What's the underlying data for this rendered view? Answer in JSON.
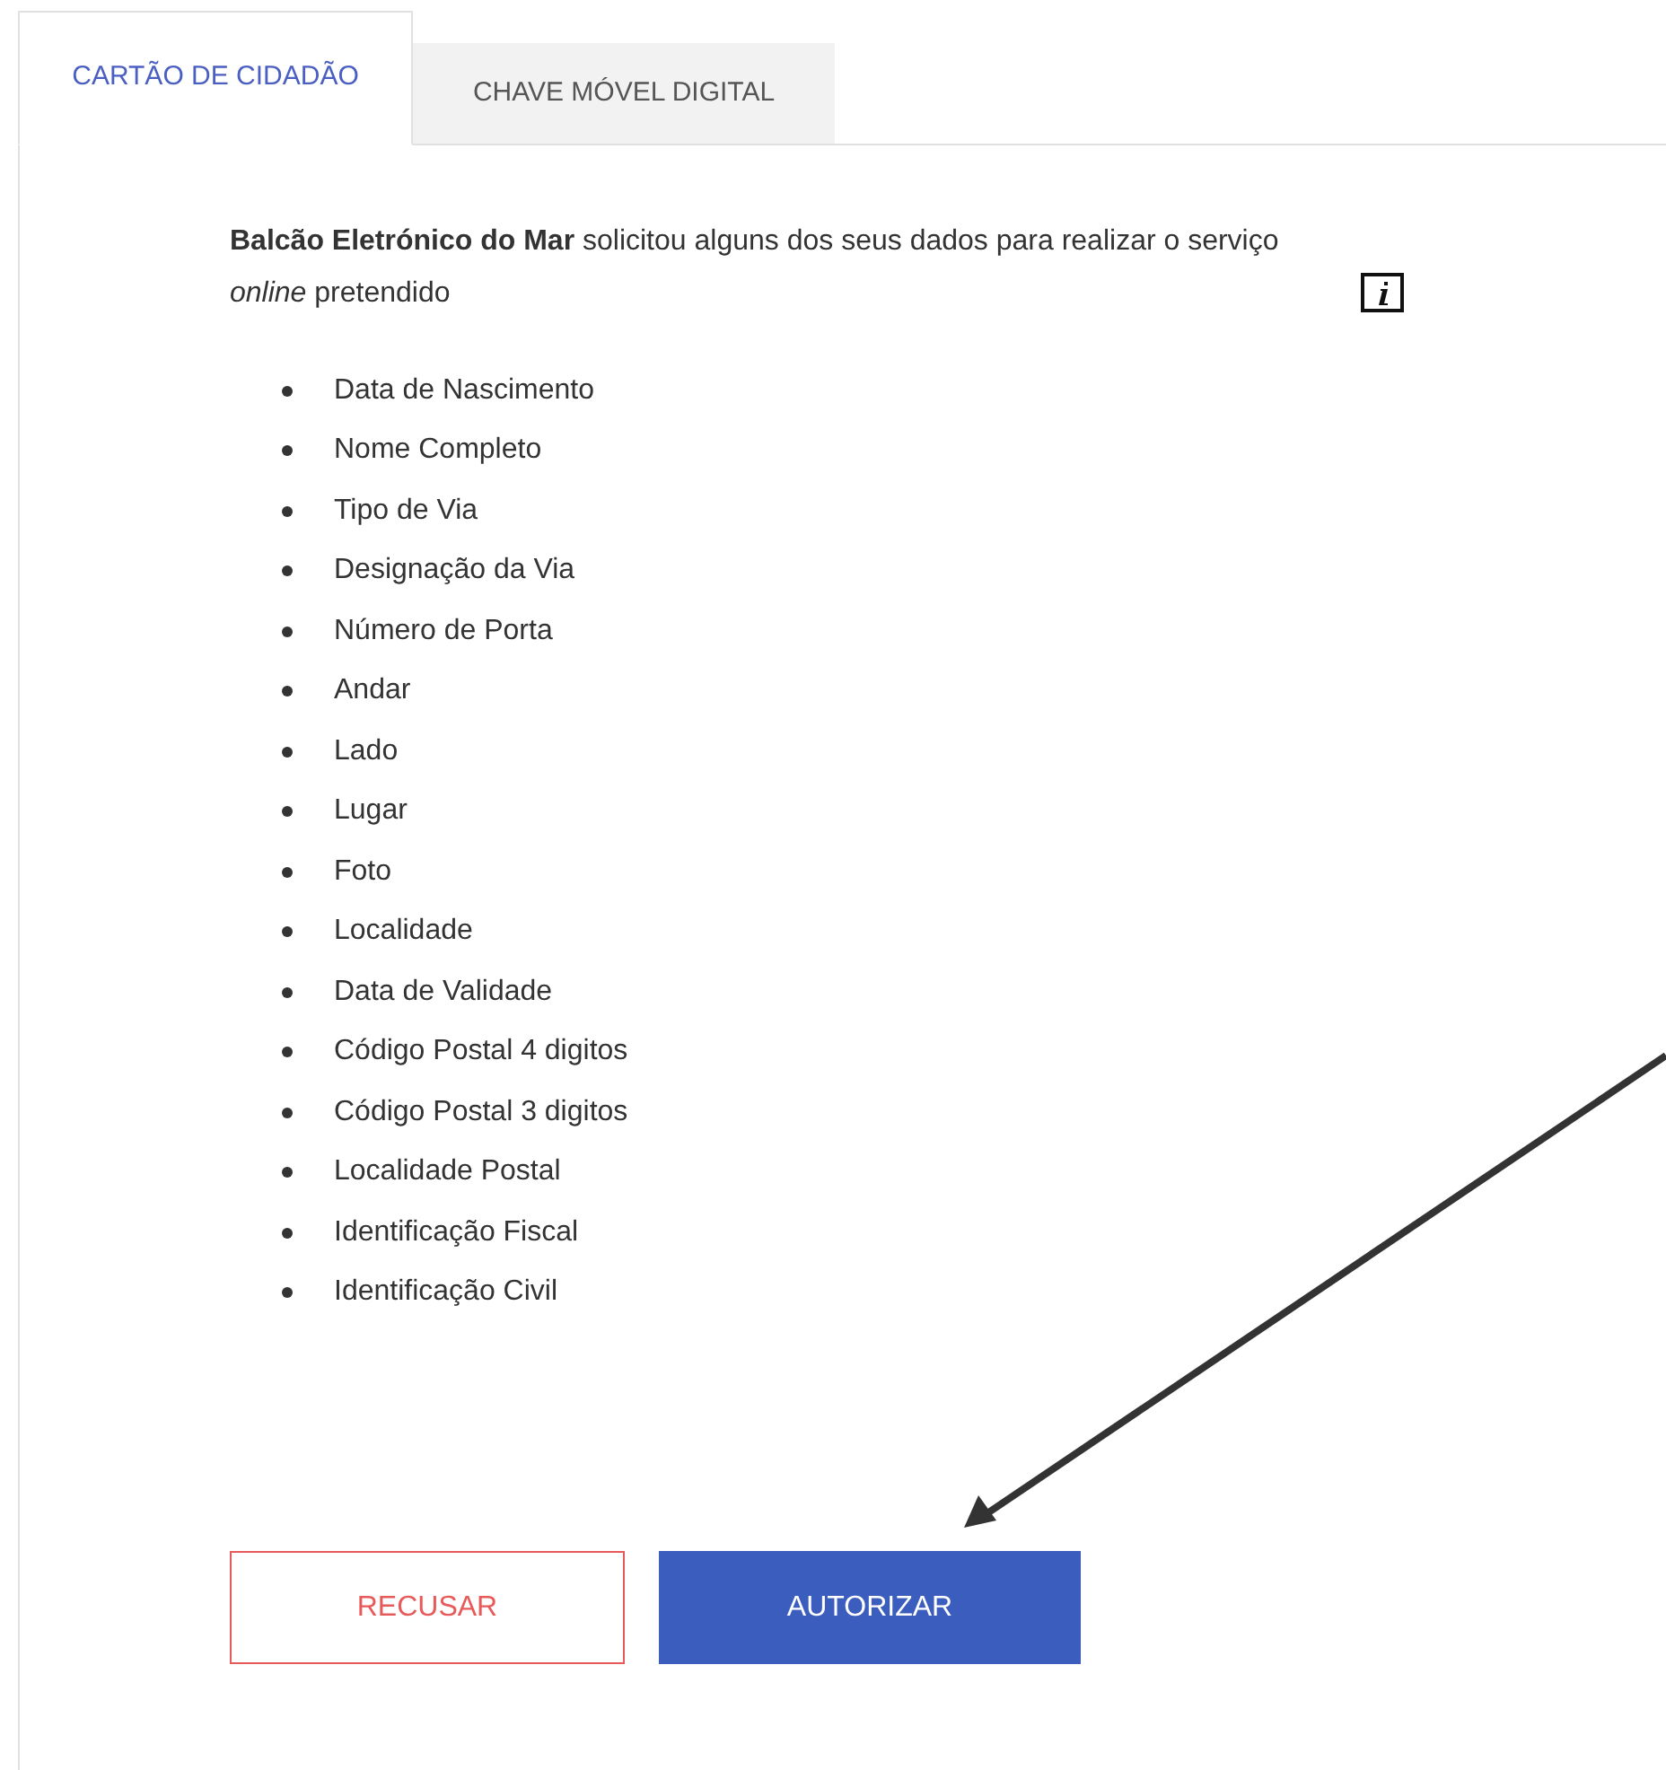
{
  "tabs": [
    {
      "label": "CARTÃO DE CIDADÃO",
      "selected": true
    },
    {
      "label": "CHAVE MÓVEL DIGITAL",
      "selected": false
    }
  ],
  "intro": "**Balcão Eletrónico do Mar**  solicitou alguns dos seus dados para realizar o serviço *online* pretendido",
  "requested_data": [
    "Data de Nascimento",
    "Nome Completo",
    "Tipo de Via",
    "Designação da Via",
    "Número de Porta",
    "Andar",
    "Lado",
    "Lugar",
    "Foto",
    "Localidade",
    "Data de Validade",
    "Código Postal 4 digitos",
    "Código Postal 3 digitos",
    "Localidade Postal",
    "Identificação Fiscal",
    "Identificação Civil"
  ],
  "buttons": [
    {
      "label": "RECUSAR",
      "kind": "secondary"
    },
    {
      "label": "AUTORIZAR",
      "kind": "primary"
    }
  ]
}
